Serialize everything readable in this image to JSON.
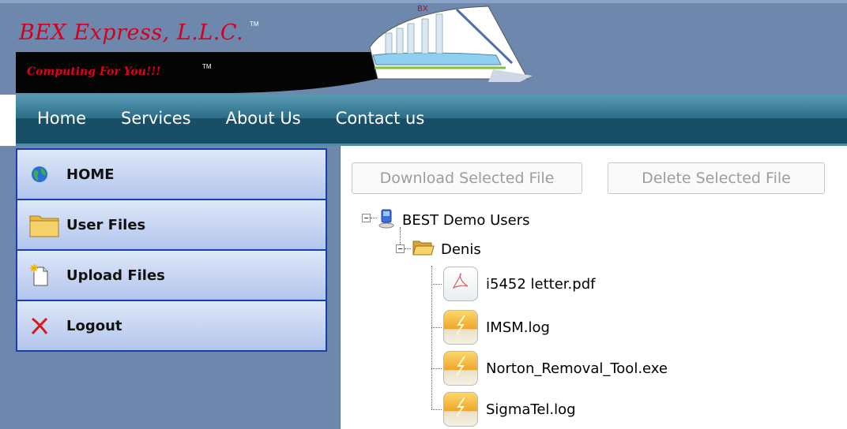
{
  "header": {
    "brand_title": "BEX Express, L.L.C.",
    "brand_tm": "TM",
    "slogan": "Computing For You!!!",
    "slogan_tm": "TM",
    "colors": {
      "header_bg": "#6d87ad",
      "brand_red": "#d4001f"
    }
  },
  "nav": {
    "items": [
      {
        "label": "Home"
      },
      {
        "label": "Services"
      },
      {
        "label": "About Us"
      },
      {
        "label": "Contact us"
      }
    ]
  },
  "sidebar": {
    "items": [
      {
        "label": "HOME",
        "icon": "globe-icon"
      },
      {
        "label": "User Files",
        "icon": "folder-icon"
      },
      {
        "label": "Upload Files",
        "icon": "new-document-icon"
      },
      {
        "label": "Logout",
        "icon": "red-x-icon"
      }
    ]
  },
  "toolbar": {
    "download_label": "Download Selected File",
    "delete_label": "Delete Selected File"
  },
  "tree": {
    "root": {
      "label": "BEST Demo Users",
      "icon": "computer-user-icon"
    },
    "user": {
      "label": "Denis",
      "icon": "open-folder-icon"
    },
    "files": [
      {
        "label": "i5452 letter.pdf",
        "icon": "pdf-file-icon"
      },
      {
        "label": "IMSM.log",
        "icon": "file-icon"
      },
      {
        "label": "Norton_Removal_Tool.exe",
        "icon": "file-icon"
      },
      {
        "label": "SigmaTel.log",
        "icon": "file-icon"
      }
    ]
  }
}
